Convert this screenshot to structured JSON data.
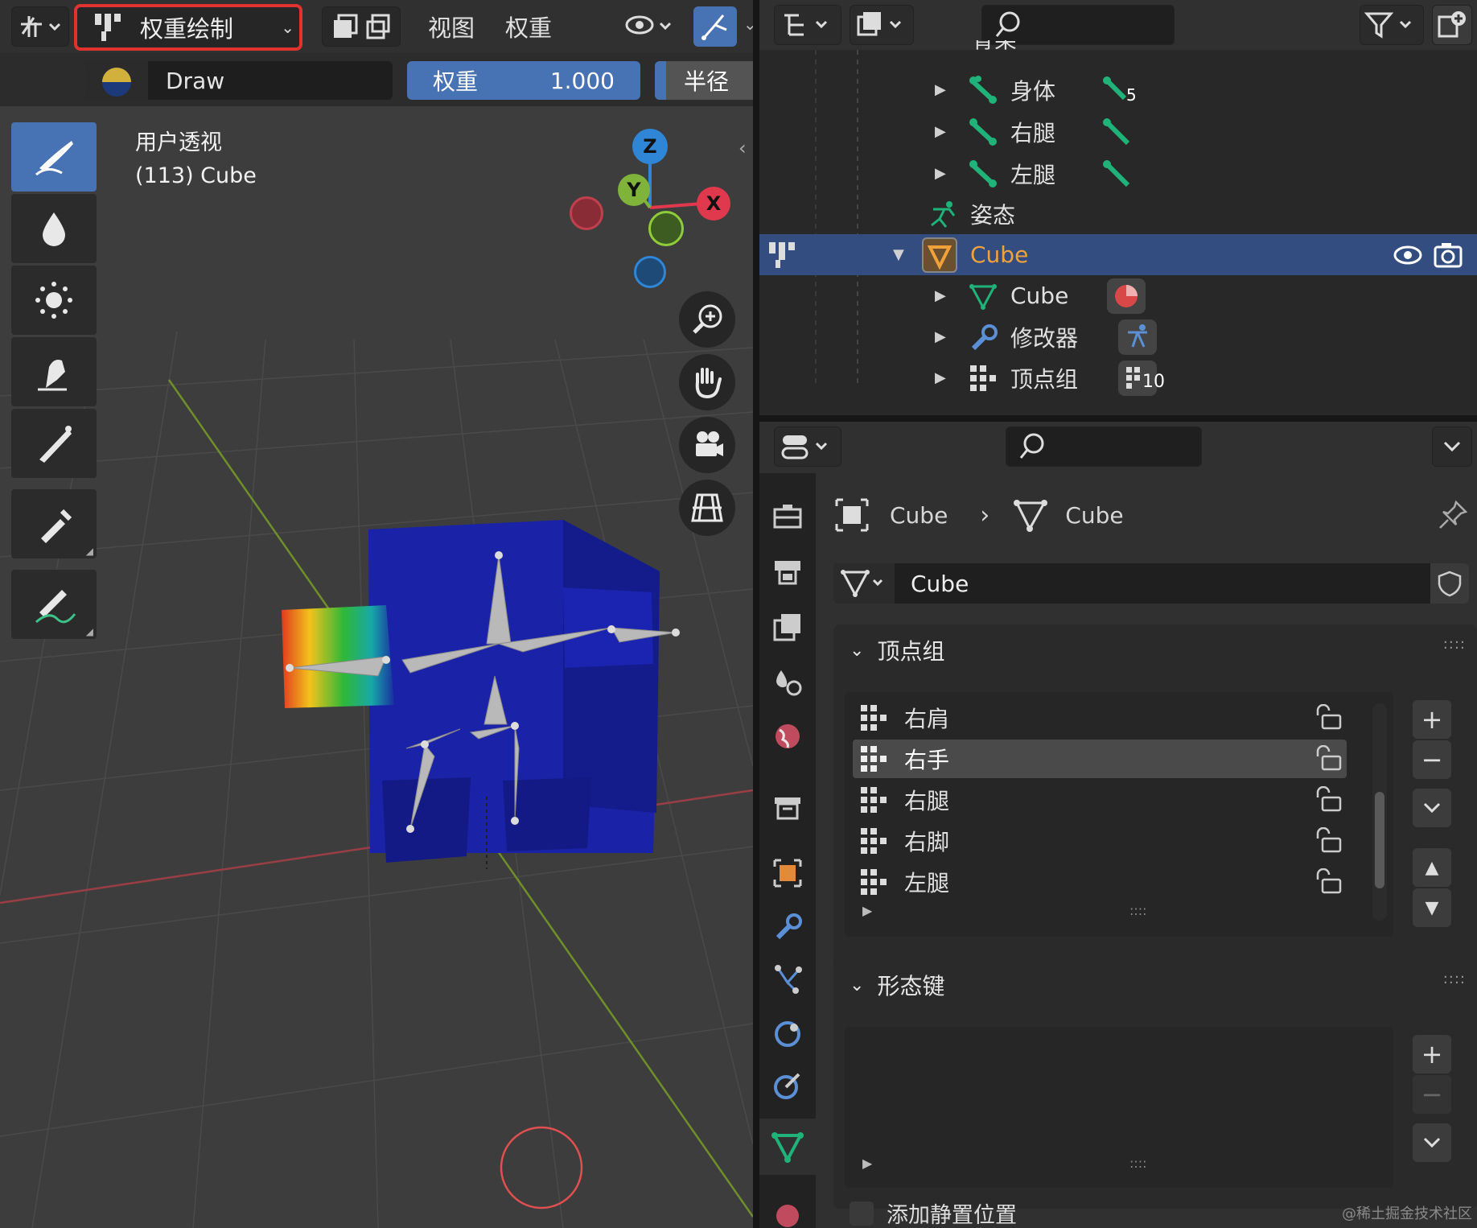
{
  "viewport": {
    "mode_label": "权重绘制",
    "menu": [
      "视图",
      "权重"
    ],
    "brush_name": "Draw",
    "weight_label": "权重",
    "weight_value": "1.000",
    "radius_label": "半径",
    "overlay_text": "用户透视",
    "object_text": "(113) Cube",
    "gizmo": {
      "z": "Z",
      "y": "Y",
      "x": "X"
    },
    "tools": [
      "draw-brush",
      "blur-brush",
      "average-brush",
      "smear-brush",
      "gradient",
      "sample-weight",
      "annotate"
    ]
  },
  "outliner": {
    "rows": [
      {
        "label": "骨架",
        "indent": 0
      },
      {
        "label": "身体",
        "badge": "5"
      },
      {
        "label": "右腿",
        "badge": ""
      },
      {
        "label": "左腿",
        "badge": ""
      },
      {
        "label": "姿态"
      },
      {
        "label": "Cube",
        "selected": true
      },
      {
        "label": "Cube"
      },
      {
        "label": "修改器"
      },
      {
        "label": "顶点组",
        "badge": "10"
      }
    ]
  },
  "properties": {
    "breadcrumb": [
      "Cube",
      "Cube"
    ],
    "datablock_name": "Cube",
    "vertex_groups": {
      "title": "顶点组",
      "items": [
        "右肩",
        "右手",
        "右腿",
        "右脚",
        "左腿"
      ],
      "selected_index": 1
    },
    "shape_keys": {
      "title": "形态键"
    },
    "add_rest_position": "添加静置位置"
  },
  "watermark": "@稀土掘金技术社区",
  "colors": {
    "selection": "#334d80",
    "active_tool": "#4772b3",
    "highlight_box": "#e0332f",
    "axis_x": "#e0394e",
    "axis_y": "#7fb33a",
    "axis_z": "#2f86d6",
    "bone_green": "#1fb37a",
    "object_orange": "#f0a13a"
  }
}
